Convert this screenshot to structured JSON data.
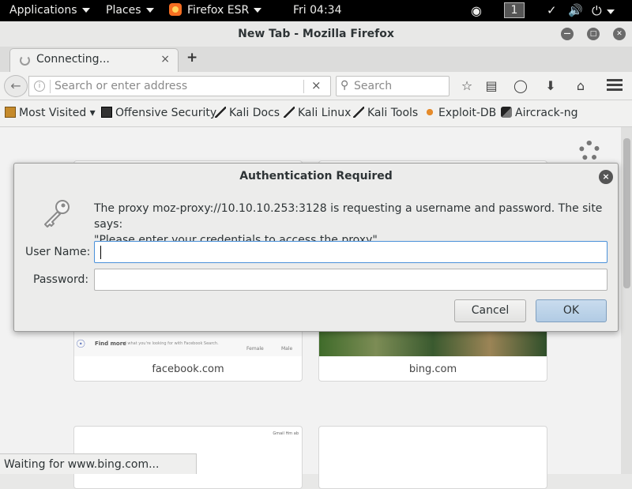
{
  "topbar": {
    "applications": "Applications",
    "places": "Places",
    "app_name": "Firefox ESR",
    "clock": "Fri 04:34",
    "workspace": "1"
  },
  "window": {
    "title": "New Tab - Mozilla Firefox"
  },
  "tab": {
    "label": "Connecting...",
    "close": "×",
    "new_tab": "+"
  },
  "navbar": {
    "url_placeholder": "Search or enter address",
    "search_placeholder": "Search",
    "clear": "×"
  },
  "bookmarks": [
    {
      "label": "Most Visited ▾",
      "icon": "folder-icon"
    },
    {
      "label": "Offensive Security",
      "icon": "offsec-icon"
    },
    {
      "label": "Kali Docs",
      "icon": "kali-icon"
    },
    {
      "label": "Kali Linux",
      "icon": "kali-icon"
    },
    {
      "label": "Kali Tools",
      "icon": "kali-icon"
    },
    {
      "label": "Exploit-DB",
      "icon": "exploitdb-icon"
    },
    {
      "label": "Aircrack-ng",
      "icon": "aircrack-icon"
    }
  ],
  "tiles": [
    {
      "caption": "facebook.com",
      "thumb_text": "Find more",
      "thumb_sub": "of what you're looking for with Facebook Search.",
      "opt1": "Female",
      "opt2": "Male"
    },
    {
      "caption": "bing.com"
    },
    {
      "caption": "",
      "thumb_text": "Gmail   Hm  ab"
    },
    {
      "caption": ""
    }
  ],
  "status": "Waiting for www.bing.com...",
  "dialog": {
    "title": "Authentication Required",
    "message_line1": "The proxy moz-proxy://10.10.10.253:3128 is requesting a username and password. The site says:",
    "message_line2": "\"Please enter your credentials to access the proxy\"",
    "username_label": "User Name:",
    "password_label": "Password:",
    "username_value": "",
    "password_value": "",
    "cancel": "Cancel",
    "ok": "OK",
    "close": "×"
  },
  "colors": {
    "ok_button": "#b1cbe4",
    "focus_border": "#4a90d9",
    "topbar": "#000000"
  }
}
